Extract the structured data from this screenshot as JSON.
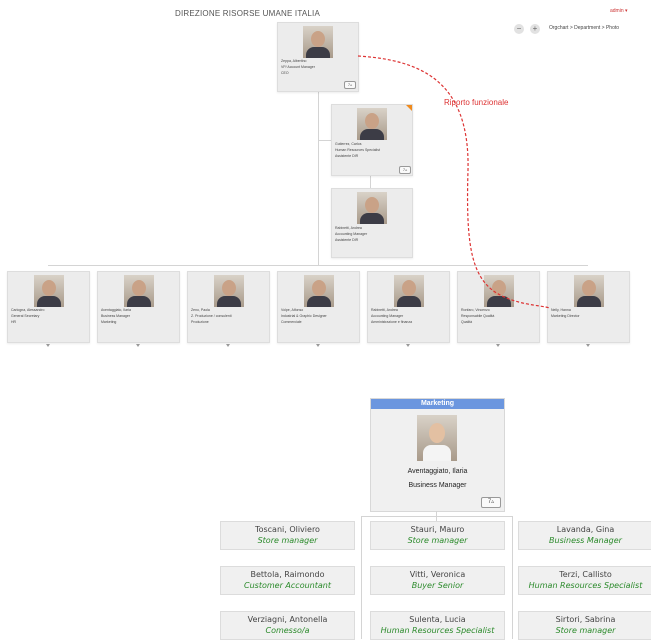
{
  "header": {
    "title": "DIREZIONE RISORSE UMANE ITALIA",
    "user_link": "admin ▾",
    "zoom_out": "−",
    "zoom_in": "+",
    "view_selector": "Orgchart > Department > Photo"
  },
  "annotation": "Riporto funzionale",
  "top": {
    "name": "Zeppa, Albertino",
    "title": "VP/ Account Manager",
    "dept": "CEO",
    "btn": "7▵"
  },
  "mid1": {
    "name": "Gutierrez, Carlos",
    "title": "Human Resources Specialist",
    "dept": "Assistente DIR",
    "btn": "7▵"
  },
  "mid2": {
    "name": "Rabinetti, Andrea",
    "title": "Accounting Manager",
    "dept": "Assistente DIR"
  },
  "row": [
    {
      "name": "Carlogna, Alessandro",
      "title": "General Secretary",
      "dept": "HR"
    },
    {
      "name": "Aventaggiato, Ilaria",
      "title": "Business Manager",
      "dept": "Marketing"
    },
    {
      "name": "Zeno, Paola",
      "title": "Z. Produzione / consulenti",
      "dept": "Produzione"
    },
    {
      "name": "Volpe, Alfonso",
      "title": "Industrial & Graphic Designer",
      "dept": "Commerciale"
    },
    {
      "name": "Rabinetti, Andrea",
      "title": "Accounting Manager",
      "dept": "Amministrazione e finanza"
    },
    {
      "name": "Ronfaro, Vincenzo",
      "title": "Responsabile Qualità",
      "dept": "Qualità"
    },
    {
      "name": "Nelly, Hanna",
      "title": "Marketing Director",
      "dept": ""
    }
  ],
  "dept_card": {
    "header": "Marketing",
    "name": "Aventaggiato, Ilaria",
    "title": "Business Manager",
    "btn": "7▵"
  },
  "subs": [
    {
      "name": "Toscani, Oliviero",
      "role": "Store manager"
    },
    {
      "name": "Stauri, Mauro",
      "role": "Store manager"
    },
    {
      "name": "Lavanda, Gina",
      "role": "Business Manager"
    },
    {
      "name": "Bettola, Raimondo",
      "role": "Customer Accountant"
    },
    {
      "name": "Vitti, Veronica",
      "role": "Buyer Senior"
    },
    {
      "name": "Terzi, Callisto",
      "role": "Human Resources Specialist"
    },
    {
      "name": "Verziagni, Antonella",
      "role": "Comesso/a"
    },
    {
      "name": "Sulenta, Lucia",
      "role": "Human Resources Specialist"
    },
    {
      "name": "Sirtori, Sabrina",
      "role": "Store manager"
    }
  ],
  "colors": {
    "accent": "#6b96df",
    "role_text": "#2b8a2b",
    "annotation": "#dd3333",
    "corner": "#f08a1c"
  }
}
